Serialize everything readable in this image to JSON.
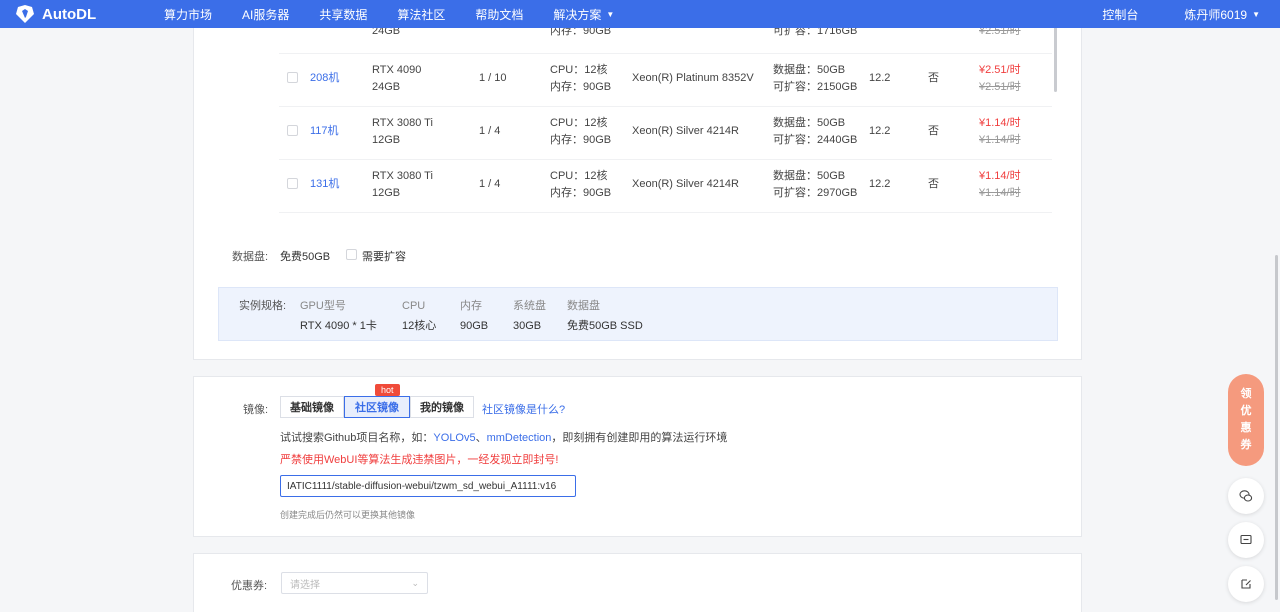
{
  "brand": {
    "name": "AutoDL",
    "color": "#3b6ee8"
  },
  "nav": {
    "items": [
      "算力市场",
      "AI服务器",
      "共享数据",
      "算法社区",
      "帮助文档",
      "解决方案"
    ],
    "console": "控制台",
    "user": "炼丹师6019"
  },
  "machines": [
    {
      "id": "",
      "gpu_model": "",
      "gpu_mem": "24GB",
      "gpu_free": "",
      "cpu": "",
      "mem": "内存：90GB",
      "cpu_model": "",
      "disk": "",
      "expand": "可扩容：1716GB",
      "cuda": "",
      "flag": "",
      "price": "",
      "price_old": "¥2.51/时"
    },
    {
      "id": "208机",
      "gpu_model": "RTX 4090",
      "gpu_mem": "24GB",
      "gpu_free": "1 / 10",
      "cpu": "CPU：12核",
      "mem": "内存：90GB",
      "cpu_model": "Xeon(R) Platinum 8352V",
      "disk": "数据盘：50GB",
      "expand": "可扩容：2150GB",
      "cuda": "12.2",
      "flag": "否",
      "price": "¥2.51/时",
      "price_old": "¥2.51/时"
    },
    {
      "id": "117机",
      "gpu_model": "RTX 3080 Ti",
      "gpu_mem": "12GB",
      "gpu_free": "1 / 4",
      "cpu": "CPU：12核",
      "mem": "内存：90GB",
      "cpu_model": "Xeon(R) Silver 4214R",
      "disk": "数据盘：50GB",
      "expand": "可扩容：2440GB",
      "cuda": "12.2",
      "flag": "否",
      "price": "¥1.14/时",
      "price_old": "¥1.14/时"
    },
    {
      "id": "131机",
      "gpu_model": "RTX 3080 Ti",
      "gpu_mem": "12GB",
      "gpu_free": "1 / 4",
      "cpu": "CPU：12核",
      "mem": "内存：90GB",
      "cpu_model": "Xeon(R) Silver 4214R",
      "disk": "数据盘：50GB",
      "expand": "可扩容：2970GB",
      "cuda": "12.2",
      "flag": "否",
      "price": "¥1.14/时",
      "price_old": "¥1.14/时"
    }
  ],
  "data_disk": {
    "label": "数据盘:",
    "value": "免费50GB",
    "expand_label": "需要扩容"
  },
  "spec": {
    "label": "实例规格:",
    "headers": [
      "GPU型号",
      "CPU",
      "内存",
      "系统盘",
      "数据盘"
    ],
    "values": [
      "RTX 4090 * 1卡",
      "12核心",
      "90GB",
      "30GB",
      "免费50GB SSD"
    ]
  },
  "mirror": {
    "label": "镜像:",
    "tabs": [
      "基础镜像",
      "社区镜像",
      "我的镜像"
    ],
    "hot": "hot",
    "help_link": "社区镜像是什么?",
    "hint_prefix": "试试搜索Github项目名称，如：",
    "hint_link1": "YOLOv5",
    "hint_sep": "、",
    "hint_link2": "mmDetection",
    "hint_suffix": "，即刻拥有创建即用的算法运行环境",
    "warning": "严禁使用WebUI等算法生成违禁图片，一经发现立即封号!",
    "input_value": "IATIC1111/stable-diffusion-webui/tzwm_sd_webui_A1111:v16",
    "note": "创建完成后仍然可以更换其他镜像"
  },
  "coupon": {
    "label": "优惠券:",
    "placeholder": "请选择"
  },
  "float": {
    "coupon_chars": [
      "领",
      "优",
      "惠",
      "券"
    ]
  }
}
